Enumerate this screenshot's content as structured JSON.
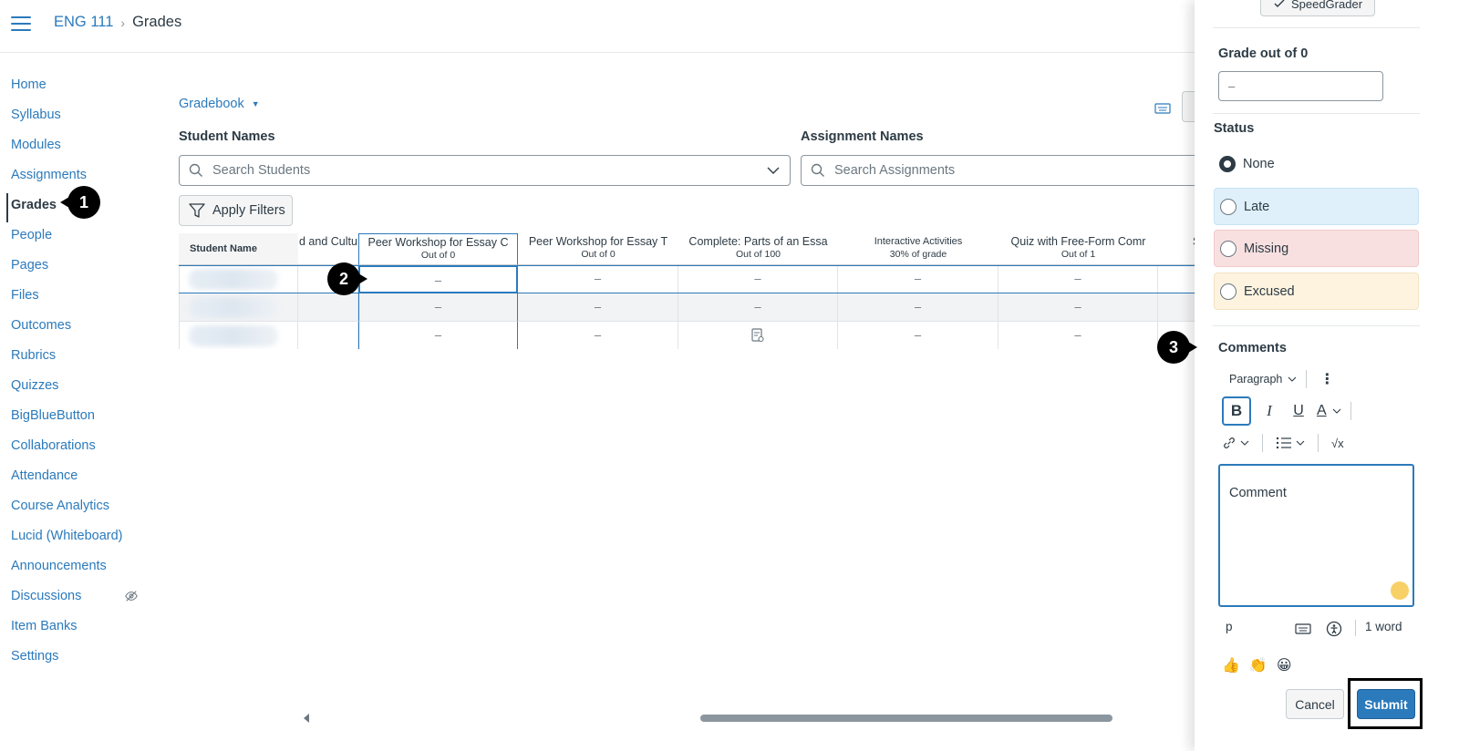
{
  "breadcrumb": {
    "course": "ENG 111",
    "separator": "›",
    "current": "Grades"
  },
  "nav": {
    "items": [
      {
        "label": "Home"
      },
      {
        "label": "Syllabus"
      },
      {
        "label": "Modules"
      },
      {
        "label": "Assignments"
      },
      {
        "label": "Grades",
        "active": true
      },
      {
        "label": "People"
      },
      {
        "label": "Pages"
      },
      {
        "label": "Files"
      },
      {
        "label": "Outcomes"
      },
      {
        "label": "Rubrics"
      },
      {
        "label": "Quizzes"
      },
      {
        "label": "BigBlueButton"
      },
      {
        "label": "Collaborations"
      },
      {
        "label": "Attendance"
      },
      {
        "label": "Course Analytics"
      },
      {
        "label": "Lucid (Whiteboard)"
      },
      {
        "label": "Announcements"
      },
      {
        "label": "Discussions",
        "hidden_icon": "eye-slash-icon"
      },
      {
        "label": "Item Banks"
      },
      {
        "label": "Settings"
      }
    ]
  },
  "callouts": {
    "one": "1",
    "two": "2",
    "three": "3"
  },
  "gradebook": {
    "menu_label": "Gradebook",
    "student_names_label": "Student Names",
    "assignment_names_label": "Assignment Names",
    "search_students_placeholder": "Search Students",
    "search_assignments_placeholder": "Search Assignments",
    "apply_filters_label": "Apply Filters"
  },
  "grid": {
    "columns": [
      {
        "title": "Student Name",
        "subtitle": ""
      },
      {
        "title": "d and Cultu",
        "subtitle": ""
      },
      {
        "title": "Peer Workshop for Essay C",
        "subtitle": "Out of 0"
      },
      {
        "title": "Peer Workshop for Essay T",
        "subtitle": "Out of 0"
      },
      {
        "title": "Complete: Parts of an Essa",
        "subtitle": "Out of 100"
      },
      {
        "title": "Interactive Activities",
        "subtitle": "30% of grade"
      },
      {
        "title": "Quiz with Free-Form Comr",
        "subtitle": "Out of 1"
      },
      {
        "title": "S",
        "subtitle": ""
      }
    ],
    "rows": [
      [
        "",
        "",
        "–",
        "–",
        "–",
        "–",
        "–",
        ""
      ],
      [
        "",
        "",
        "–",
        "–",
        "–",
        "–",
        "–",
        ""
      ],
      [
        "",
        "",
        "–",
        "–",
        "",
        "–",
        "–",
        ""
      ]
    ]
  },
  "tray": {
    "speedgrader_label": "SpeedGrader",
    "grade_label": "Grade out of 0",
    "grade_value": "–",
    "status_label": "Status",
    "status_options": [
      "None",
      "Late",
      "Missing",
      "Excused"
    ],
    "selected_status": "None",
    "comments_label": "Comments",
    "block_format": "Paragraph",
    "comment_text": "Comment",
    "path_label": "p",
    "word_count": "1 word",
    "cancel_label": "Cancel",
    "submit_label": "Submit",
    "colors": {
      "accent": "#2b7abc",
      "late": "#e0f0fa",
      "missing": "#f9e0e0",
      "excused": "#fdf3df"
    }
  }
}
